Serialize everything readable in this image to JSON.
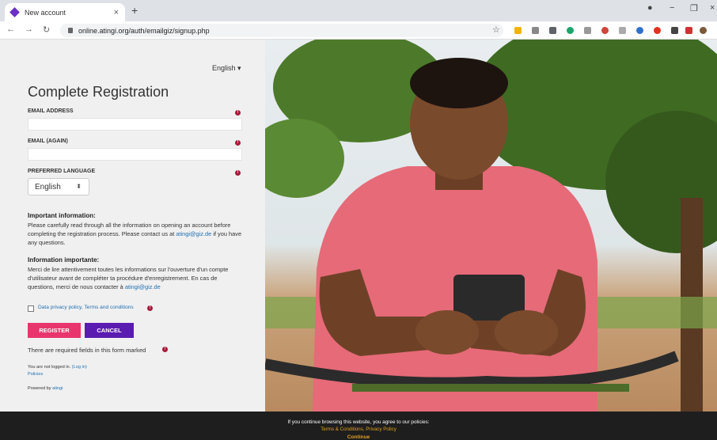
{
  "browser": {
    "tab_title": "New account",
    "tab_close": "×",
    "new_tab": "+",
    "url": "online.atingi.org/auth/emailgiz/signup.php",
    "colors": {
      "tab_favicon": "#6b2fc8"
    }
  },
  "form": {
    "language_menu": "English",
    "title": "Complete Registration",
    "fields": [
      {
        "label": "EMAIL ADDRESS",
        "value": ""
      },
      {
        "label": "EMAIL (AGAIN)",
        "value": ""
      }
    ],
    "preferred_language": {
      "label": "PREFERRED LANGUAGE",
      "selected": "English"
    },
    "required_icon": "!"
  },
  "info": {
    "en_heading": "Important information:",
    "en_text": "Please carefully read through all the information on opening an account before completing the registration process. Please contact us at",
    "en_email": "atingi@giz.de",
    "en_tail": "if you have any questions.",
    "fr_heading": "Information importante:",
    "fr_text": "Merci de lire attentivement toutes les informations sur l'ouverture d'un compte d'utilisateur avant de compléter ta procédure d'enregistrement. En cas de questions, merci de nous contacter à",
    "fr_email": "atingi@giz.de"
  },
  "policy": {
    "label": "Data privacy policy, Terms and conditions"
  },
  "buttons": {
    "register": "REGISTER",
    "cancel": "CANCEL"
  },
  "notes": {
    "required_note": "There are required fields in this form marked",
    "not_logged": "You are not logged in.",
    "login_link": "(Log in)",
    "policies": "Policies",
    "powered_by": "Powered by",
    "powered_link": "atingi"
  },
  "cookie": {
    "message": "If you continue browsing this website, you agree to our policies:",
    "links": "Terms & Conditions, Privacy Policy",
    "continue": "Continue"
  },
  "colors": {
    "register_button": "#e9356d",
    "cancel_button": "#5a1bb0",
    "required_icon": "#a8193b",
    "link": "#1f6fb2",
    "cookie_link": "#e2a21c"
  }
}
